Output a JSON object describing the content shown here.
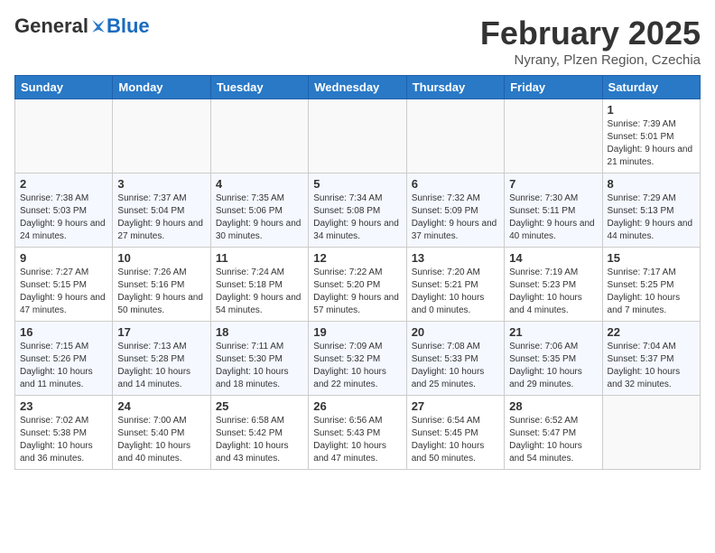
{
  "header": {
    "logo_general": "General",
    "logo_blue": "Blue",
    "month_title": "February 2025",
    "location": "Nyrany, Plzen Region, Czechia"
  },
  "weekdays": [
    "Sunday",
    "Monday",
    "Tuesday",
    "Wednesday",
    "Thursday",
    "Friday",
    "Saturday"
  ],
  "weeks": [
    [
      {
        "day": "",
        "info": ""
      },
      {
        "day": "",
        "info": ""
      },
      {
        "day": "",
        "info": ""
      },
      {
        "day": "",
        "info": ""
      },
      {
        "day": "",
        "info": ""
      },
      {
        "day": "",
        "info": ""
      },
      {
        "day": "1",
        "info": "Sunrise: 7:39 AM\nSunset: 5:01 PM\nDaylight: 9 hours and 21 minutes."
      }
    ],
    [
      {
        "day": "2",
        "info": "Sunrise: 7:38 AM\nSunset: 5:03 PM\nDaylight: 9 hours and 24 minutes."
      },
      {
        "day": "3",
        "info": "Sunrise: 7:37 AM\nSunset: 5:04 PM\nDaylight: 9 hours and 27 minutes."
      },
      {
        "day": "4",
        "info": "Sunrise: 7:35 AM\nSunset: 5:06 PM\nDaylight: 9 hours and 30 minutes."
      },
      {
        "day": "5",
        "info": "Sunrise: 7:34 AM\nSunset: 5:08 PM\nDaylight: 9 hours and 34 minutes."
      },
      {
        "day": "6",
        "info": "Sunrise: 7:32 AM\nSunset: 5:09 PM\nDaylight: 9 hours and 37 minutes."
      },
      {
        "day": "7",
        "info": "Sunrise: 7:30 AM\nSunset: 5:11 PM\nDaylight: 9 hours and 40 minutes."
      },
      {
        "day": "8",
        "info": "Sunrise: 7:29 AM\nSunset: 5:13 PM\nDaylight: 9 hours and 44 minutes."
      }
    ],
    [
      {
        "day": "9",
        "info": "Sunrise: 7:27 AM\nSunset: 5:15 PM\nDaylight: 9 hours and 47 minutes."
      },
      {
        "day": "10",
        "info": "Sunrise: 7:26 AM\nSunset: 5:16 PM\nDaylight: 9 hours and 50 minutes."
      },
      {
        "day": "11",
        "info": "Sunrise: 7:24 AM\nSunset: 5:18 PM\nDaylight: 9 hours and 54 minutes."
      },
      {
        "day": "12",
        "info": "Sunrise: 7:22 AM\nSunset: 5:20 PM\nDaylight: 9 hours and 57 minutes."
      },
      {
        "day": "13",
        "info": "Sunrise: 7:20 AM\nSunset: 5:21 PM\nDaylight: 10 hours and 0 minutes."
      },
      {
        "day": "14",
        "info": "Sunrise: 7:19 AM\nSunset: 5:23 PM\nDaylight: 10 hours and 4 minutes."
      },
      {
        "day": "15",
        "info": "Sunrise: 7:17 AM\nSunset: 5:25 PM\nDaylight: 10 hours and 7 minutes."
      }
    ],
    [
      {
        "day": "16",
        "info": "Sunrise: 7:15 AM\nSunset: 5:26 PM\nDaylight: 10 hours and 11 minutes."
      },
      {
        "day": "17",
        "info": "Sunrise: 7:13 AM\nSunset: 5:28 PM\nDaylight: 10 hours and 14 minutes."
      },
      {
        "day": "18",
        "info": "Sunrise: 7:11 AM\nSunset: 5:30 PM\nDaylight: 10 hours and 18 minutes."
      },
      {
        "day": "19",
        "info": "Sunrise: 7:09 AM\nSunset: 5:32 PM\nDaylight: 10 hours and 22 minutes."
      },
      {
        "day": "20",
        "info": "Sunrise: 7:08 AM\nSunset: 5:33 PM\nDaylight: 10 hours and 25 minutes."
      },
      {
        "day": "21",
        "info": "Sunrise: 7:06 AM\nSunset: 5:35 PM\nDaylight: 10 hours and 29 minutes."
      },
      {
        "day": "22",
        "info": "Sunrise: 7:04 AM\nSunset: 5:37 PM\nDaylight: 10 hours and 32 minutes."
      }
    ],
    [
      {
        "day": "23",
        "info": "Sunrise: 7:02 AM\nSunset: 5:38 PM\nDaylight: 10 hours and 36 minutes."
      },
      {
        "day": "24",
        "info": "Sunrise: 7:00 AM\nSunset: 5:40 PM\nDaylight: 10 hours and 40 minutes."
      },
      {
        "day": "25",
        "info": "Sunrise: 6:58 AM\nSunset: 5:42 PM\nDaylight: 10 hours and 43 minutes."
      },
      {
        "day": "26",
        "info": "Sunrise: 6:56 AM\nSunset: 5:43 PM\nDaylight: 10 hours and 47 minutes."
      },
      {
        "day": "27",
        "info": "Sunrise: 6:54 AM\nSunset: 5:45 PM\nDaylight: 10 hours and 50 minutes."
      },
      {
        "day": "28",
        "info": "Sunrise: 6:52 AM\nSunset: 5:47 PM\nDaylight: 10 hours and 54 minutes."
      },
      {
        "day": "",
        "info": ""
      }
    ]
  ]
}
